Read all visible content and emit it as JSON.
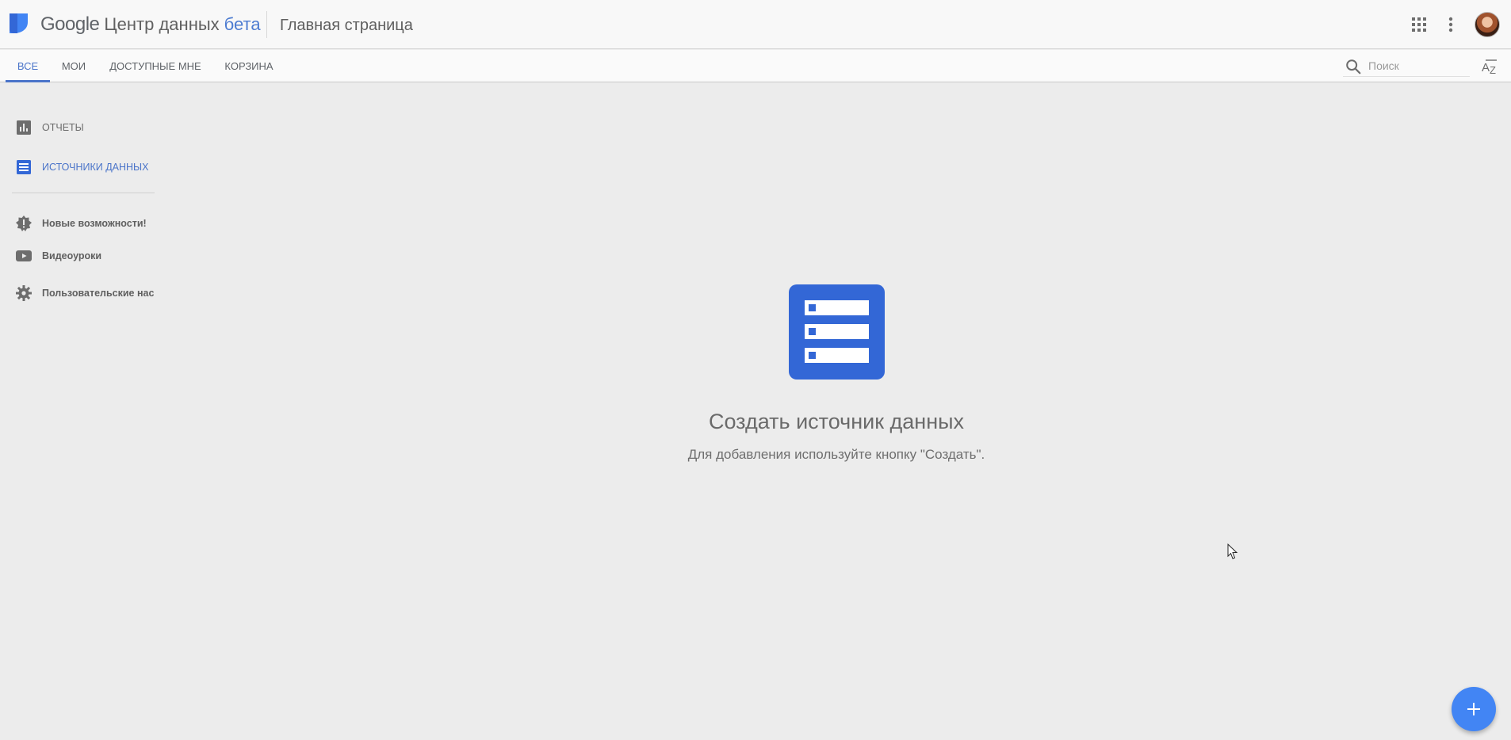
{
  "header": {
    "brand_google": "Google",
    "brand_product": "Центр данных",
    "brand_beta": "бета",
    "page_title": "Главная страница",
    "icons": [
      "logo-icon",
      "apps-grid-icon",
      "more-vert-icon",
      "avatar"
    ]
  },
  "tabs": [
    {
      "label": "ВСЕ",
      "active": true
    },
    {
      "label": "МОИ",
      "active": false
    },
    {
      "label": "ДОСТУПНЫЕ МНЕ",
      "active": false
    },
    {
      "label": "КОРЗИНА",
      "active": false
    }
  ],
  "search": {
    "placeholder": "Поиск",
    "value": ""
  },
  "sort": {
    "icon": "sort-az-icon"
  },
  "sidebar": {
    "items": [
      {
        "label": "ОТЧЕТЫ",
        "icon": "bar-chart-icon",
        "active": false
      },
      {
        "label": "ИСТОЧНИКИ ДАННЫХ",
        "icon": "list-icon",
        "active": true
      },
      {
        "label": "Новые возможности!",
        "icon": "new-badge-icon",
        "active": false
      },
      {
        "label": "Видеоуроки",
        "icon": "youtube-icon",
        "active": false
      },
      {
        "label": "Пользовательские нас",
        "icon": "gear-icon",
        "active": false
      }
    ]
  },
  "empty_state": {
    "icon": "data-source-icon",
    "title": "Создать источник данных",
    "subtitle": "Для добавления используйте кнопку \"Создать\"."
  },
  "fab": {
    "icon": "plus-icon"
  },
  "colors": {
    "accent": "#4a74c9",
    "fab": "#4285f4",
    "data_icon": "#3367d6",
    "background": "#ececec"
  }
}
